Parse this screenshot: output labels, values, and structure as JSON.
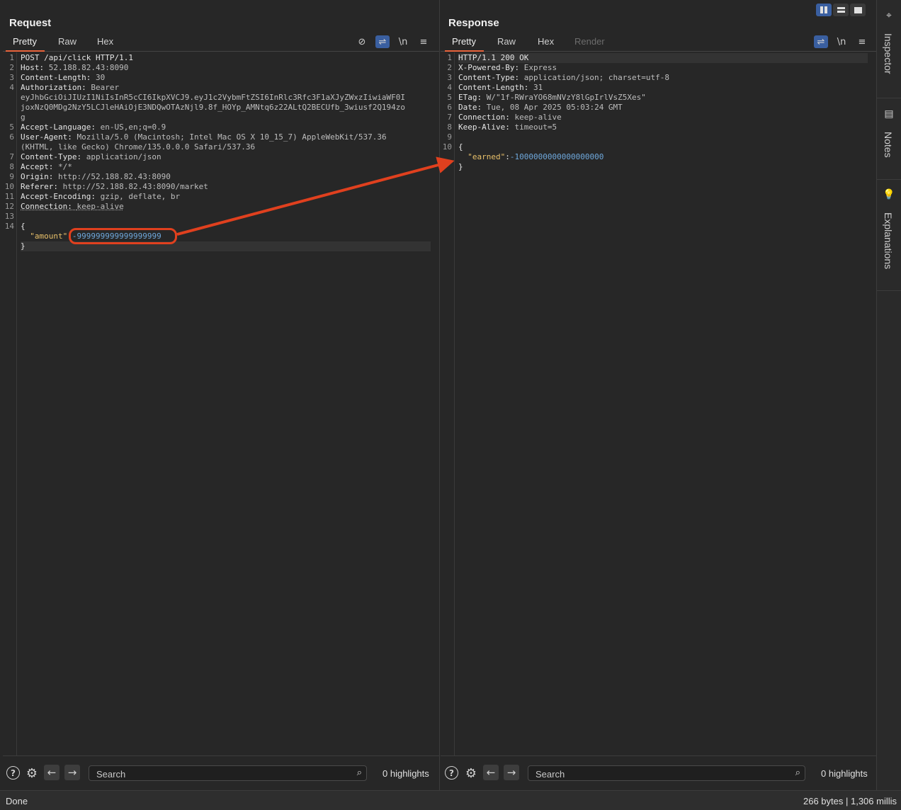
{
  "request": {
    "title": "Request",
    "tabs": [
      "Pretty",
      "Raw",
      "Hex"
    ],
    "lines": [
      {
        "n": "1",
        "parts": [
          {
            "t": "POST /api/click HTTP/1.1",
            "c": "hname"
          }
        ]
      },
      {
        "n": "2",
        "parts": [
          {
            "t": "Host: ",
            "c": "hname"
          },
          {
            "t": "52.188.82.43:8090",
            "c": "hval"
          }
        ]
      },
      {
        "n": "3",
        "parts": [
          {
            "t": "Content-Length: ",
            "c": "hname"
          },
          {
            "t": "30",
            "c": "hval"
          }
        ]
      },
      {
        "n": "4",
        "parts": [
          {
            "t": "Authorization: ",
            "c": "hname"
          },
          {
            "t": "Bearer",
            "c": "hval"
          }
        ]
      },
      {
        "n": "",
        "parts": [
          {
            "t": "eyJhbGciOiJIUzI1NiIsInR5cCI6IkpXVCJ9.eyJ1c2VybmFtZSI6InRlc3Rfc3F1aXJyZWxzIiwiaWF0I",
            "c": "hval"
          }
        ]
      },
      {
        "n": "",
        "parts": [
          {
            "t": "joxNzQ0MDg2NzY5LCJleHAiOjE3NDQwOTAzNjl9.8f_HOYp_AMNtq6z22ALtQ2BECUfb_3wiusf2Q194zo",
            "c": "hval"
          }
        ]
      },
      {
        "n": "",
        "parts": [
          {
            "t": "g",
            "c": "hval"
          }
        ]
      },
      {
        "n": "5",
        "parts": [
          {
            "t": "Accept-Language: ",
            "c": "hname"
          },
          {
            "t": "en-US,en;q=0.9",
            "c": "hval"
          }
        ]
      },
      {
        "n": "6",
        "parts": [
          {
            "t": "User-Agent: ",
            "c": "hname"
          },
          {
            "t": "Mozilla/5.0 (Macintosh; Intel Mac OS X 10_15_7) AppleWebKit/537.36",
            "c": "hval"
          }
        ]
      },
      {
        "n": "",
        "parts": [
          {
            "t": "(KHTML, like Gecko) Chrome/135.0.0.0 Safari/537.36",
            "c": "hval"
          }
        ]
      },
      {
        "n": "7",
        "parts": [
          {
            "t": "Content-Type: ",
            "c": "hname"
          },
          {
            "t": "application/json",
            "c": "hval"
          }
        ]
      },
      {
        "n": "8",
        "parts": [
          {
            "t": "Accept: ",
            "c": "hname"
          },
          {
            "t": "*/*",
            "c": "hval"
          }
        ]
      },
      {
        "n": "9",
        "parts": [
          {
            "t": "Origin: ",
            "c": "hname"
          },
          {
            "t": "http://52.188.82.43:8090",
            "c": "hval"
          }
        ]
      },
      {
        "n": "10",
        "parts": [
          {
            "t": "Referer: ",
            "c": "hname"
          },
          {
            "t": "http://52.188.82.43:8090/market",
            "c": "hval"
          }
        ]
      },
      {
        "n": "11",
        "parts": [
          {
            "t": "Accept-Encoding: ",
            "c": "hname"
          },
          {
            "t": "gzip, deflate, br",
            "c": "hval"
          }
        ]
      },
      {
        "n": "12",
        "parts": [
          {
            "t": "Connection: ",
            "c": "hname uline"
          },
          {
            "t": "keep-alive",
            "c": "hval uline"
          }
        ]
      },
      {
        "n": "13",
        "parts": [
          {
            "t": "",
            "c": "hval"
          }
        ]
      },
      {
        "n": "14",
        "parts": [
          {
            "t": "{",
            "c": "hname"
          }
        ]
      },
      {
        "n": "",
        "parts": [
          {
            "t": "  ",
            "c": "hname"
          },
          {
            "t": "\"amount\"",
            "c": "jkey"
          },
          {
            "t": ":",
            "c": "hname"
          },
          {
            "t": "-999999999999999999",
            "c": "jnum"
          }
        ]
      },
      {
        "n": "",
        "cur": true,
        "parts": [
          {
            "t": "}",
            "c": "hname"
          }
        ]
      }
    ],
    "search_placeholder": "Search",
    "highlights": "0 highlights"
  },
  "response": {
    "title": "Response",
    "tabs": [
      "Pretty",
      "Raw",
      "Hex",
      "Render"
    ],
    "lines": [
      {
        "n": "1",
        "cur": true,
        "parts": [
          {
            "t": "HTTP/1.1 200 OK",
            "c": "hname"
          }
        ]
      },
      {
        "n": "2",
        "parts": [
          {
            "t": "X-Powered-By: ",
            "c": "hname"
          },
          {
            "t": "Express",
            "c": "hval"
          }
        ]
      },
      {
        "n": "3",
        "parts": [
          {
            "t": "Content-Type: ",
            "c": "hname"
          },
          {
            "t": "application/json; charset=utf-8",
            "c": "hval"
          }
        ]
      },
      {
        "n": "4",
        "parts": [
          {
            "t": "Content-Length: ",
            "c": "hname"
          },
          {
            "t": "31",
            "c": "hval"
          }
        ]
      },
      {
        "n": "5",
        "parts": [
          {
            "t": "ETag: ",
            "c": "hname"
          },
          {
            "t": "W/\"1f-RWraYO68mNVzY8lGpIrlVsZ5Xes\"",
            "c": "hval"
          }
        ]
      },
      {
        "n": "6",
        "parts": [
          {
            "t": "Date: ",
            "c": "hname"
          },
          {
            "t": "Tue, 08 Apr 2025 05:03:24 GMT",
            "c": "hval"
          }
        ]
      },
      {
        "n": "7",
        "parts": [
          {
            "t": "Connection: ",
            "c": "hname"
          },
          {
            "t": "keep-alive",
            "c": "hval"
          }
        ]
      },
      {
        "n": "8",
        "parts": [
          {
            "t": "Keep-Alive: ",
            "c": "hname"
          },
          {
            "t": "timeout=5",
            "c": "hval"
          }
        ]
      },
      {
        "n": "9",
        "parts": [
          {
            "t": "",
            "c": "hval"
          }
        ]
      },
      {
        "n": "10",
        "parts": [
          {
            "t": "{",
            "c": "hname"
          }
        ]
      },
      {
        "n": "",
        "parts": [
          {
            "t": "  ",
            "c": "hname"
          },
          {
            "t": "\"earned\"",
            "c": "jkey"
          },
          {
            "t": ":",
            "c": "hname"
          },
          {
            "t": "-1000000000000000000",
            "c": "jnum"
          }
        ]
      },
      {
        "n": "",
        "parts": [
          {
            "t": "}",
            "c": "hname"
          }
        ]
      }
    ],
    "search_placeholder": "Search",
    "highlights": "0 highlights"
  },
  "sidebar": {
    "items": [
      {
        "label": "Inspector",
        "icon": "inspector-icon"
      },
      {
        "label": "Notes",
        "icon": "notes-icon"
      },
      {
        "label": "Explanations",
        "icon": "lightbulb-icon"
      }
    ]
  },
  "toolbar_glyphs": {
    "newline": "\\n",
    "menu": "≡",
    "eye_off": "⊘",
    "wrap": "⇌"
  },
  "status": {
    "left": "Done",
    "right": "266 bytes | 1,306 millis"
  },
  "colors": {
    "accent": "#e8643c",
    "annotation": "#e0401e",
    "toggle_on": "#3a5fa0",
    "json_key": "#e8c06a",
    "json_number": "#6fa8dc"
  }
}
